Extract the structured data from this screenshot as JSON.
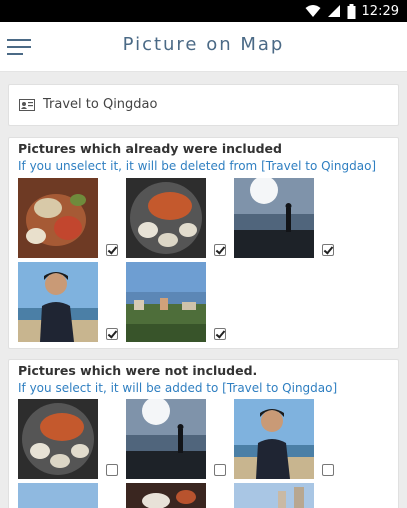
{
  "status_bar": {
    "time": "12:29"
  },
  "app_bar": {
    "title": "Picture on Map"
  },
  "trip": {
    "name": "Travel to Qingdao"
  },
  "included": {
    "title": "Pictures which already were included",
    "subtitle": "If you unselect it, it will be deleted from [Travel to Qingdao]",
    "photos": [
      {
        "checked": true
      },
      {
        "checked": true
      },
      {
        "checked": true
      },
      {
        "checked": true
      },
      {
        "checked": true
      }
    ]
  },
  "excluded": {
    "title": "Pictures which were not included.",
    "subtitle": "If you select it, it will be added to [Travel to Qingdao]",
    "photos": [
      {
        "checked": false
      },
      {
        "checked": false
      },
      {
        "checked": false
      }
    ]
  }
}
